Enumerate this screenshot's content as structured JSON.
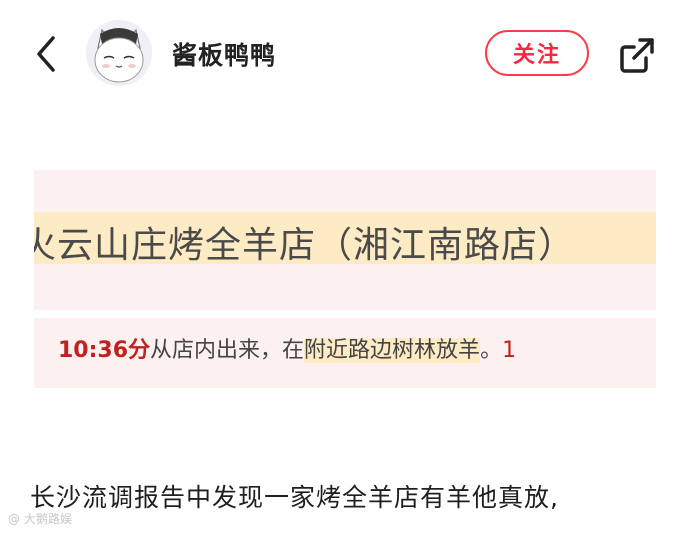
{
  "header": {
    "username": "酱板鸭鸭",
    "follow_label": "关注"
  },
  "post_image": {
    "title_text": "火云山庄烤全羊店（湘江南路店）",
    "time_text": "10:36分",
    "sentence_pre": "从店内出来，在",
    "sentence_hl": "附近路边树林放羊",
    "sentence_end": "。",
    "tail_mark": "1"
  },
  "caption": "长沙流调报告中发现一家烤全羊店有羊他真放,",
  "watermark": "大鹅路娱"
}
